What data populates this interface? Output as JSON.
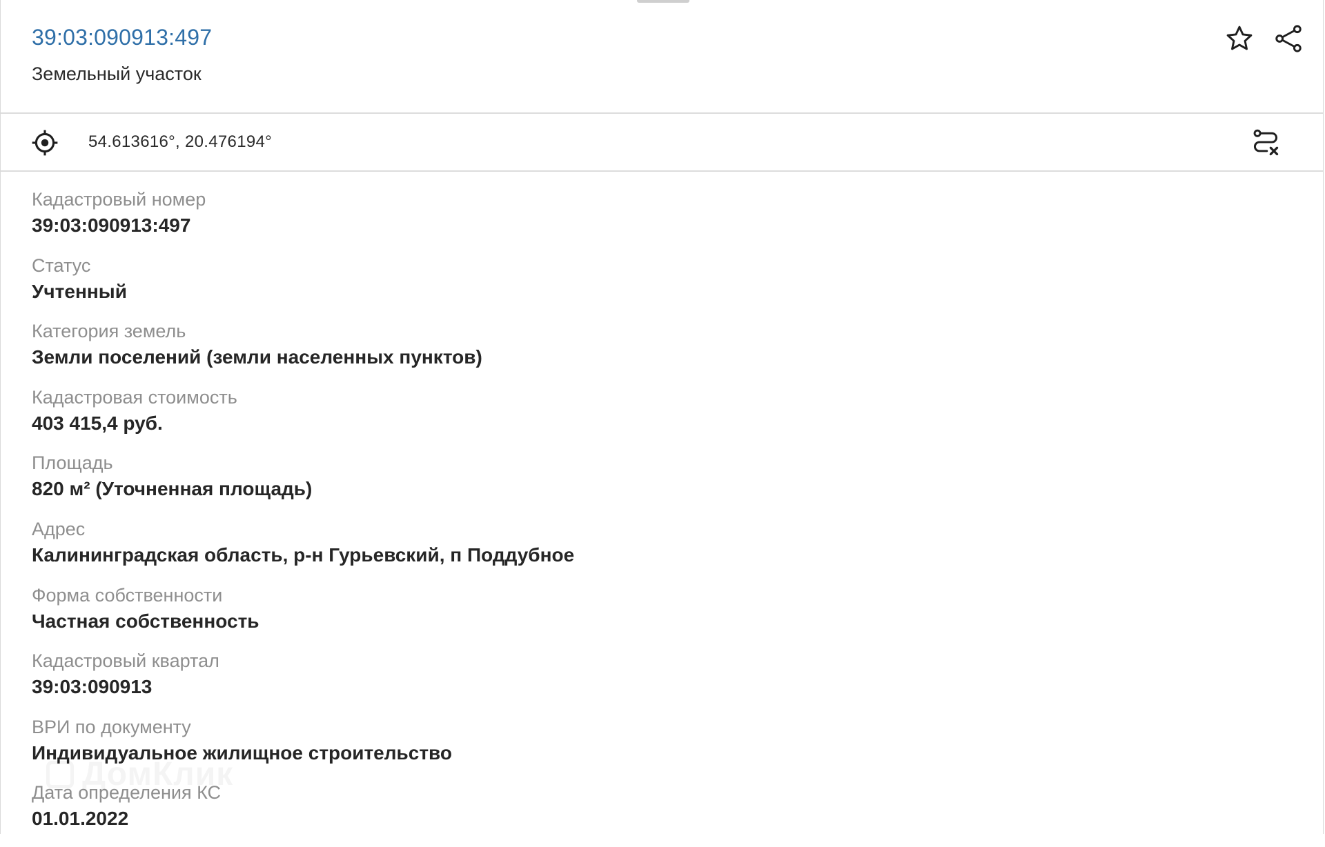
{
  "header": {
    "cadastral_number_link": "39:03:090913:497",
    "object_type": "Земельный участок",
    "actions": {
      "favorite_icon": "star-outline-icon",
      "share_icon": "share-icon"
    }
  },
  "coords_bar": {
    "locate_icon": "crosshair-location-icon",
    "coordinates": "54.613616°, 20.476194°",
    "route_icon": "route-cancel-icon"
  },
  "details": [
    {
      "label": "Кадастровый номер",
      "value": "39:03:090913:497"
    },
    {
      "label": "Статус",
      "value": "Учтенный"
    },
    {
      "label": "Категория земель",
      "value": "Земли поселений (земли населенных пунктов)"
    },
    {
      "label": "Кадастровая стоимость",
      "value": "403 415,4 руб."
    },
    {
      "label": "Площадь",
      "value": "820 м² (Уточненная площадь)"
    },
    {
      "label": "Адрес",
      "value": "Калининградская область, р-н Гурьевский, п Поддубное"
    },
    {
      "label": "Форма собственности",
      "value": "Частная собственность"
    },
    {
      "label": "Кадастровый квартал",
      "value": "39:03:090913"
    },
    {
      "label": "ВРИ по документу",
      "value": "Индивидуальное жилищное строительство"
    },
    {
      "label": "Дата определения КС",
      "value": "01.01.2022"
    }
  ],
  "watermark": "ДомКлик",
  "colors": {
    "link": "#2f6fa8",
    "label": "#8e8e8e",
    "value": "#262626",
    "divider": "#dcdcdc"
  }
}
